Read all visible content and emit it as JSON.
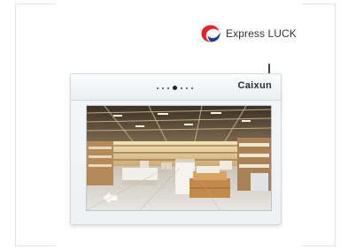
{
  "logo": {
    "text": "Express LUCK",
    "mark_icon": "express-luck-swirl-logo",
    "mark_colors": [
      "#e3232b",
      "#1f3e8c"
    ]
  },
  "device": {
    "brand": "Caixun",
    "indicator_dots": 7,
    "active_dot_index": 3,
    "screen_content": "retail store interior photo"
  }
}
